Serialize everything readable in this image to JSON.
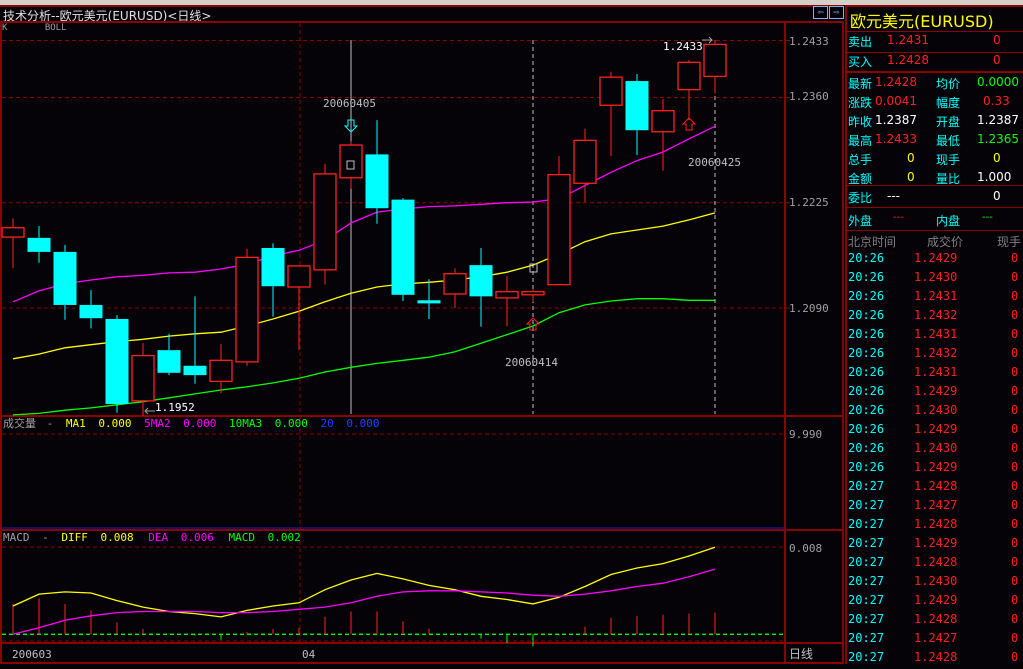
{
  "window": {
    "title": "技术分析--欧元美元(EURUSD)<日线>",
    "nav_prev_icon": "arrow-left-icon",
    "nav_next_icon": "arrow-right-icon"
  },
  "main_panel": {
    "indicator_k": "K",
    "indicator_boll": "BOLL"
  },
  "volume_panel": {
    "name": "成交量",
    "dash": "-",
    "ma1_label": "MA1",
    "ma1_value": "0.000",
    "ma2_label": "5MA2",
    "ma2_value": "0.000",
    "ma3_label": "10MA3",
    "ma3_value": "0.000",
    "ma4_label": "20",
    "ma4_value": "0.000",
    "axis_label": "9.990"
  },
  "macd_panel": {
    "name": "MACD",
    "dash": "-",
    "diff_label": "DIFF",
    "diff_value": "0.008",
    "dea_label": "DEA",
    "dea_value": "0.006",
    "macd_label": "MACD",
    "macd_value": "0.002",
    "axis_label": "0.008"
  },
  "bottom_axis": {
    "start_label": "200603",
    "month_label": "04",
    "period_label": "日线"
  },
  "colors": {
    "up": "#ff2020",
    "down": "#00ffff",
    "boll_upper": "#ff00ff",
    "boll_mid": "#ffff00",
    "boll_lower": "#00ff00",
    "grid": "#8b0000",
    "diff": "#ffff00",
    "dea": "#ff00ff"
  },
  "chart_data": {
    "type": "candlestick",
    "price_axis_ticks": [
      "1.2433",
      "1.2360",
      "1.2225",
      "1.2090"
    ],
    "annotations": {
      "high_label": "1.2433",
      "low_label": "1.1952",
      "marker_dates": [
        "20060405",
        "20060414",
        "20060425"
      ]
    },
    "candles": [
      {
        "o": 1.2181,
        "h": 1.2205,
        "l": 1.2141,
        "c": 1.2193
      },
      {
        "o": 1.218,
        "h": 1.2195,
        "l": 1.2148,
        "c": 1.2162
      },
      {
        "o": 1.2162,
        "h": 1.2171,
        "l": 1.2075,
        "c": 1.2094
      },
      {
        "o": 1.2094,
        "h": 1.2113,
        "l": 1.2064,
        "c": 1.2077
      },
      {
        "o": 1.2076,
        "h": 1.2081,
        "l": 1.1956,
        "c": 1.1967
      },
      {
        "o": 1.1971,
        "h": 1.2045,
        "l": 1.1952,
        "c": 1.2029
      },
      {
        "o": 1.2036,
        "h": 1.2057,
        "l": 1.2004,
        "c": 1.2007
      },
      {
        "o": 1.2016,
        "h": 1.2105,
        "l": 1.1993,
        "c": 1.2004
      },
      {
        "o": 1.1996,
        "h": 1.2044,
        "l": 1.1981,
        "c": 1.2023
      },
      {
        "o": 1.2021,
        "h": 1.2166,
        "l": 1.2016,
        "c": 1.2155
      },
      {
        "o": 1.2167,
        "h": 1.2173,
        "l": 1.2079,
        "c": 1.2118
      },
      {
        "o": 1.2117,
        "h": 1.2145,
        "l": 1.2036,
        "c": 1.2144
      },
      {
        "o": 1.2139,
        "h": 1.2275,
        "l": 1.212,
        "c": 1.2262
      },
      {
        "o": 1.2257,
        "h": 1.2304,
        "l": 1.2243,
        "c": 1.2299
      },
      {
        "o": 1.2287,
        "h": 1.2331,
        "l": 1.2198,
        "c": 1.2218
      },
      {
        "o": 1.2229,
        "h": 1.2231,
        "l": 1.2099,
        "c": 1.2107
      },
      {
        "o": 1.21,
        "h": 1.2127,
        "l": 1.2076,
        "c": 1.2096
      },
      {
        "o": 1.2108,
        "h": 1.2141,
        "l": 1.209,
        "c": 1.2134
      },
      {
        "o": 1.2145,
        "h": 1.2167,
        "l": 1.2066,
        "c": 1.2105
      },
      {
        "o": 1.2103,
        "h": 1.2131,
        "l": 1.2067,
        "c": 1.2111
      },
      {
        "o": 1.2107,
        "h": 1.2114,
        "l": 1.2098,
        "c": 1.2111
      },
      {
        "o": 1.212,
        "h": 1.2285,
        "l": 1.212,
        "c": 1.2261
      },
      {
        "o": 1.225,
        "h": 1.232,
        "l": 1.2226,
        "c": 1.2305
      },
      {
        "o": 1.235,
        "h": 1.2393,
        "l": 1.2285,
        "c": 1.2386
      },
      {
        "o": 1.2381,
        "h": 1.239,
        "l": 1.2286,
        "c": 1.2318
      },
      {
        "o": 1.2316,
        "h": 1.2358,
        "l": 1.2266,
        "c": 1.2343
      },
      {
        "o": 1.237,
        "h": 1.2408,
        "l": 1.2331,
        "c": 1.2405
      },
      {
        "o": 1.2387,
        "h": 1.2433,
        "l": 1.2365,
        "c": 1.2428
      }
    ],
    "boll_upper": [
      1.2098,
      1.2112,
      1.2121,
      1.2126,
      1.213,
      1.2132,
      1.2135,
      1.2136,
      1.214,
      1.2146,
      1.2157,
      1.2164,
      1.2177,
      1.2199,
      1.2213,
      1.2217,
      1.222,
      1.2221,
      1.2223,
      1.2225,
      1.2226,
      1.223,
      1.2247,
      1.2264,
      1.2279,
      1.229,
      1.2307,
      1.2323
    ],
    "boll_mid": [
      1.2025,
      1.2031,
      1.2039,
      1.2043,
      1.2047,
      1.205,
      1.2054,
      1.2057,
      1.2059,
      1.2067,
      1.2076,
      1.2086,
      1.2098,
      1.2109,
      1.2117,
      1.2121,
      1.2123,
      1.2126,
      1.213,
      1.2136,
      1.2145,
      1.2159,
      1.2175,
      1.2185,
      1.219,
      1.2195,
      1.2203,
      1.2212
    ],
    "boll_lower": [
      1.1953,
      1.1955,
      1.1959,
      1.1962,
      1.1966,
      1.197,
      1.1975,
      1.198,
      1.1985,
      1.1989,
      1.1994,
      1.2,
      1.2008,
      1.2014,
      1.2019,
      1.2023,
      1.2027,
      1.2034,
      1.2045,
      1.2056,
      1.2067,
      1.2084,
      1.2094,
      1.2099,
      1.2102,
      1.2102,
      1.21,
      1.21
    ],
    "diff": [
      0.0026,
      0.0037,
      0.0039,
      0.0038,
      0.0031,
      0.0025,
      0.0021,
      0.0019,
      0.0016,
      0.0022,
      0.0026,
      0.0029,
      0.0041,
      0.005,
      0.0056,
      0.0051,
      0.0045,
      0.0041,
      0.0035,
      0.0032,
      0.0028,
      0.0034,
      0.0044,
      0.0055,
      0.0061,
      0.0065,
      0.0072,
      0.008
    ],
    "dea": [
      0.0,
      0.0006,
      0.0013,
      0.0017,
      0.002,
      0.0021,
      0.0021,
      0.0021,
      0.002,
      0.002,
      0.0021,
      0.0023,
      0.0025,
      0.0029,
      0.0035,
      0.0039,
      0.004,
      0.004,
      0.0039,
      0.0038,
      0.0036,
      0.0035,
      0.0037,
      0.004,
      0.0044,
      0.0047,
      0.0053,
      0.006
    ],
    "macd": [
      0.0028,
      0.0033,
      0.0028,
      0.0022,
      0.0011,
      0.0005,
      0.0001,
      -0.0001,
      -0.0005,
      0.0002,
      0.0005,
      0.0006,
      0.0016,
      0.0021,
      0.0021,
      0.0012,
      0.0005,
      0.0001,
      -0.0004,
      -0.0008,
      -0.0011,
      -0.0001,
      0.0007,
      0.0015,
      0.0017,
      0.0018,
      0.0019,
      0.002
    ]
  },
  "quote": {
    "title": "欧元美元(EURUSD)",
    "sell": {
      "label": "卖出",
      "price": "1.2431",
      "vol": "0"
    },
    "buy": {
      "label": "买入",
      "price": "1.2428",
      "vol": "0"
    },
    "rows": [
      {
        "l1": "最新",
        "v1": "1.2428",
        "c1": "red",
        "l2": "均价",
        "v2": "0.0000",
        "c2": "grn"
      },
      {
        "l1": "涨跌",
        "v1": "0.0041",
        "c1": "red",
        "l2": "幅度",
        "v2": "0.33",
        "c2": "red"
      },
      {
        "l1": "昨收",
        "v1": "1.2387",
        "c1": "wht",
        "l2": "开盘",
        "v2": "1.2387",
        "c2": "wht"
      },
      {
        "l1": "最高",
        "v1": "1.2433",
        "c1": "red",
        "l2": "最低",
        "v2": "1.2365",
        "c2": "grn"
      },
      {
        "l1": "总手",
        "v1": "0",
        "c1": "yel",
        "l2": "现手",
        "v2": "0",
        "c2": "yel"
      },
      {
        "l1": "金额",
        "v1": "0",
        "c1": "yel",
        "l2": "量比",
        "v2": "1.000",
        "c2": "wht"
      }
    ],
    "weibi": {
      "label": "委比",
      "value": "---",
      "diff": "0"
    },
    "outer": {
      "label": "外盘",
      "value": "---"
    },
    "inner": {
      "label": "内盘",
      "value": "---"
    },
    "ticks_header": {
      "time": "北京时间",
      "price": "成交价",
      "vol": "现手"
    },
    "ticks": [
      {
        "time": "20:26",
        "price": "1.2429",
        "vol": "0"
      },
      {
        "time": "20:26",
        "price": "1.2430",
        "vol": "0"
      },
      {
        "time": "20:26",
        "price": "1.2431",
        "vol": "0"
      },
      {
        "time": "20:26",
        "price": "1.2432",
        "vol": "0"
      },
      {
        "time": "20:26",
        "price": "1.2431",
        "vol": "0"
      },
      {
        "time": "20:26",
        "price": "1.2432",
        "vol": "0"
      },
      {
        "time": "20:26",
        "price": "1.2431",
        "vol": "0"
      },
      {
        "time": "20:26",
        "price": "1.2429",
        "vol": "0"
      },
      {
        "time": "20:26",
        "price": "1.2430",
        "vol": "0"
      },
      {
        "time": "20:26",
        "price": "1.2429",
        "vol": "0"
      },
      {
        "time": "20:26",
        "price": "1.2430",
        "vol": "0"
      },
      {
        "time": "20:26",
        "price": "1.2429",
        "vol": "0"
      },
      {
        "time": "20:27",
        "price": "1.2428",
        "vol": "0"
      },
      {
        "time": "20:27",
        "price": "1.2427",
        "vol": "0"
      },
      {
        "time": "20:27",
        "price": "1.2428",
        "vol": "0"
      },
      {
        "time": "20:27",
        "price": "1.2429",
        "vol": "0"
      },
      {
        "time": "20:27",
        "price": "1.2428",
        "vol": "0"
      },
      {
        "time": "20:27",
        "price": "1.2430",
        "vol": "0"
      },
      {
        "time": "20:27",
        "price": "1.2429",
        "vol": "0"
      },
      {
        "time": "20:27",
        "price": "1.2428",
        "vol": "0"
      },
      {
        "time": "20:27",
        "price": "1.2427",
        "vol": "0"
      },
      {
        "time": "20:27",
        "price": "1.2428",
        "vol": "0"
      }
    ]
  }
}
